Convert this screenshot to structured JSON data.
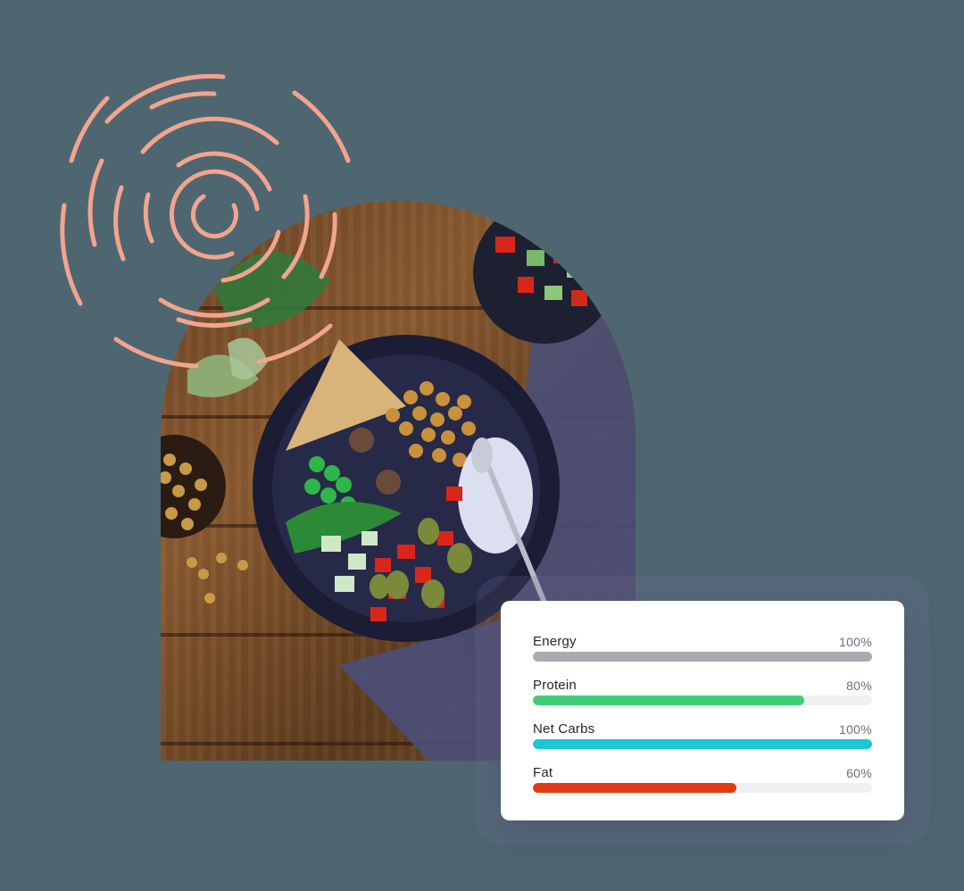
{
  "image": {
    "subject": "Food bowl photo"
  },
  "nutrition": {
    "items": [
      {
        "label": "Energy",
        "value_text": "100%",
        "value": 100,
        "color": "#a9aab2"
      },
      {
        "label": "Protein",
        "value_text": "80%",
        "value": 80,
        "color": "#3ecf76"
      },
      {
        "label": "Net Carbs",
        "value_text": "100%",
        "value": 100,
        "color": "#1ec6d4"
      },
      {
        "label": "Fat",
        "value_text": "60%",
        "value": 60,
        "color": "#e23a12"
      }
    ]
  },
  "colors": {
    "background": "#4e6670",
    "rings": "#f2a48e",
    "card": "#ffffff"
  }
}
